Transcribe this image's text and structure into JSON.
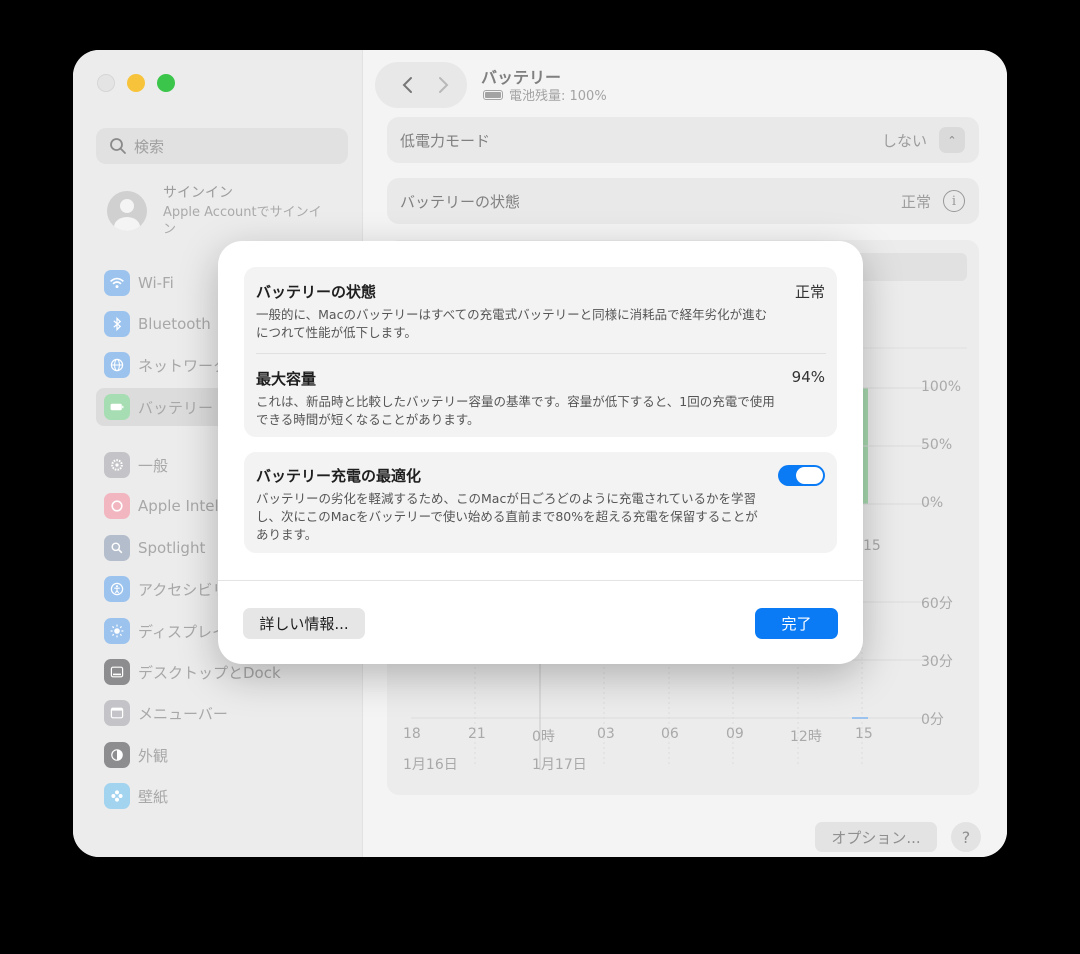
{
  "sidebar": {
    "search_placeholder": "検索",
    "account": {
      "title": "サインイン",
      "subtitle": "Apple Accountでサインイン"
    },
    "items": [
      {
        "label": "Wi-Fi",
        "icon": "wifi-icon",
        "color": "#2f8cf6"
      },
      {
        "label": "Bluetooth",
        "icon": "bluetooth-icon",
        "color": "#2f8cf6"
      },
      {
        "label": "ネットワーク",
        "icon": "globe-icon",
        "color": "#2f8cf6"
      },
      {
        "label": "バッテリー",
        "icon": "battery-icon",
        "color": "#34c759"
      },
      {
        "label": "一般",
        "icon": "gear-icon",
        "color": "#8e8e93"
      },
      {
        "label": "Apple Intelligence",
        "icon": "apple-intelligence-icon",
        "color": "#ff6b5a"
      },
      {
        "label": "Spotlight",
        "icon": "spotlight-icon",
        "color": "#6e7c92"
      },
      {
        "label": "アクセシビリティ",
        "icon": "accessibility-icon",
        "color": "#2f8cf6"
      },
      {
        "label": "ディスプレイ",
        "icon": "sun-icon",
        "color": "#2f8cf6"
      },
      {
        "label": "デスクトップとDock",
        "icon": "dock-icon",
        "color": "#3a3a3c"
      },
      {
        "label": "メニューバー",
        "icon": "menubar-icon",
        "color": "#8e8e93"
      },
      {
        "label": "外観",
        "icon": "appearance-icon",
        "color": "#3a3a3c"
      },
      {
        "label": "壁紙",
        "icon": "wallpaper-icon",
        "color": "#34a8e8"
      }
    ]
  },
  "main": {
    "title": "バッテリー",
    "subtitle": "電池残量: 100%",
    "low_power": {
      "label": "低電力モード",
      "value": "しない"
    },
    "health": {
      "label": "バッテリーの状態",
      "value": "正常"
    },
    "options_label": "オプション...",
    "help_label": "?"
  },
  "chart_data": [
    {
      "type": "bar",
      "title": "",
      "ylim": [
        0,
        100
      ],
      "y_ticks": [
        "100%",
        "50%",
        "0%"
      ],
      "x_ticks": [
        "15"
      ],
      "color": "#34c759"
    },
    {
      "type": "bar",
      "title": "",
      "ylim": [
        0,
        60
      ],
      "y_ticks": [
        "60分",
        "30分",
        "0分"
      ],
      "x_ticks": [
        "18",
        "21",
        "0時",
        "03",
        "06",
        "09",
        "12時",
        "15"
      ],
      "date_labels": [
        "1月16日",
        "1月17日"
      ],
      "color": "#2f8cf6"
    }
  ],
  "modal": {
    "health": {
      "title": "バッテリーの状態",
      "value": "正常",
      "desc": "一般的に、Macのバッテリーはすべての充電式バッテリーと同様に消耗品で経年劣化が進むにつれて性能が低下します。"
    },
    "capacity": {
      "title": "最大容量",
      "value": "94%",
      "desc": "これは、新品時と比較したバッテリー容量の基準です。容量が低下すると、1回の充電で使用できる時間が短くなることがあります。"
    },
    "optimize": {
      "title": "バッテリー充電の最適化",
      "desc": "バッテリーの劣化を軽減するため、このMacが日ごろどのように充電されているかを学習し、次にこのMacをバッテリーで使い始める直前まで80%を超える充電を保留することがあります。",
      "enabled": true
    },
    "more_label": "詳しい情報...",
    "done_label": "完了"
  }
}
